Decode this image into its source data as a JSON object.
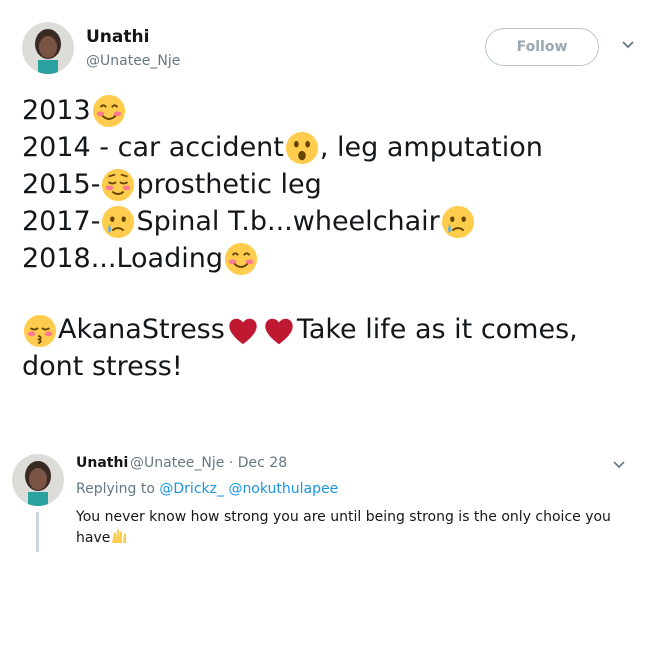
{
  "tweet": {
    "display_name": "Unathi",
    "handle": "@Unatee_Nje",
    "follow_label": "Follow",
    "lines": [
      {
        "text_before": "2013 ",
        "emoji_after": "smiling-blush-emoji"
      },
      {
        "text_before": "2014 - car accident",
        "emoji_mid": "hushed-emoji",
        "text_after": ", leg amputation"
      },
      {
        "text_before": "2015- ",
        "emoji_mid": "relieved-blush-emoji",
        "text_after": "prosthetic leg"
      },
      {
        "text_before": "2017- ",
        "emoji_mid": "sad-tear-emoji",
        "text_after": " Spinal T.b...wheelchair",
        "emoji_after": "sad-tear-emoji"
      },
      {
        "text_before": "2018...Loading",
        "emoji_after": "smiling-blush-emoji"
      }
    ],
    "closing_text_1": "AkanaStress",
    "closing_text_2": "Take life as it comes, dont stress!"
  },
  "reply": {
    "display_name": "Unathi",
    "handle": "@Unatee_Nje",
    "date": "Dec 28",
    "meta": "@Unatee_Nje · Dec 28",
    "replying_prefix": "Replying to",
    "mention_1": "@Drickz_",
    "mention_2": "@nokuthulapee",
    "text": "You never know how strong you are until being strong is the only choice you have"
  },
  "colors": {
    "text": "#14171a",
    "secondary": "#657786",
    "link": "#1b95e0",
    "emoji_yellow": "#ffcc4d",
    "heart_red": "#dd2e44"
  }
}
